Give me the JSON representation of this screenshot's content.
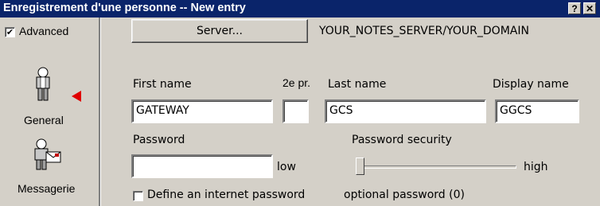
{
  "window": {
    "title": "Enregistrement d'une personne -- New entry",
    "help_label": "?",
    "close_label": "✕"
  },
  "sidebar": {
    "advanced_label": "Advanced",
    "advanced_checked": true,
    "items": [
      {
        "label": "General",
        "icon": "person-icon",
        "selected": true
      },
      {
        "label": "Messagerie",
        "icon": "mail-person-icon"
      }
    ]
  },
  "server": {
    "button_label": "Server...",
    "value": "YOUR_NOTES_SERVER/YOUR_DOMAIN"
  },
  "fields": {
    "first_name": {
      "label": "First name",
      "value": "GATEWAY"
    },
    "middle_initial": {
      "label": "2e pr.",
      "value": ""
    },
    "last_name": {
      "label": "Last name",
      "value": "GCS"
    },
    "display_name": {
      "label": "Display name",
      "value": "GGCS"
    },
    "password": {
      "label": "Password",
      "value": "",
      "strength": "low"
    },
    "password_security": {
      "label": "Password security",
      "high_label": "high",
      "level": 0
    }
  },
  "internet_password": {
    "label": "Define an internet password",
    "checked": false,
    "optional_text": "optional password (0)"
  },
  "colors": {
    "title_bar": "#0a246a",
    "face": "#d4d0c8",
    "arrow": "#e00000"
  }
}
